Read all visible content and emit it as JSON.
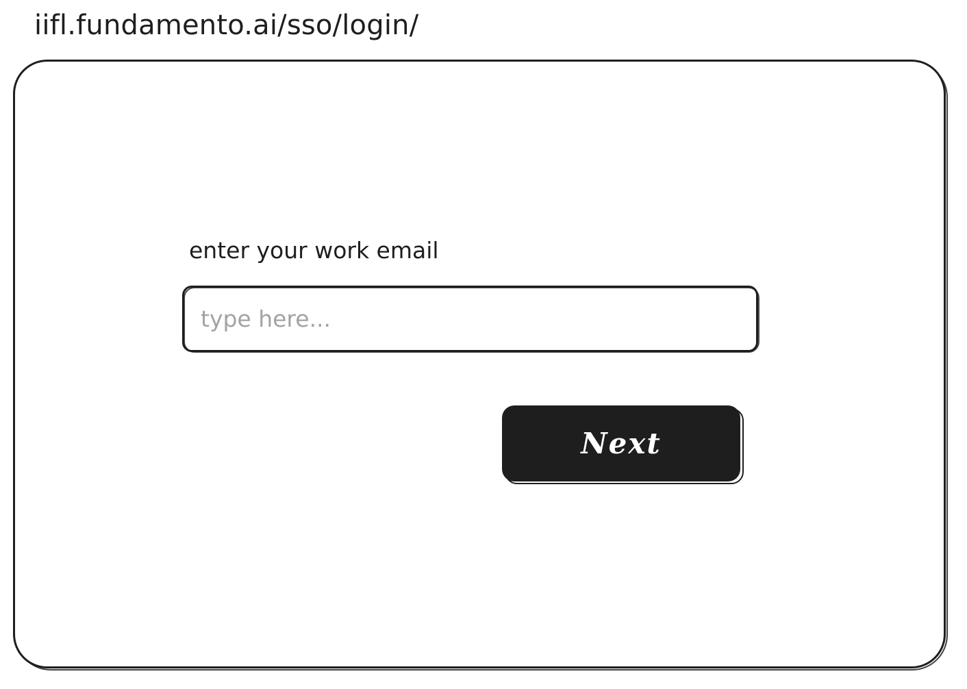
{
  "address_bar": {
    "url": "iifl.fundamento.ai/sso/login/"
  },
  "login_form": {
    "email_label": "enter your work email",
    "email_placeholder": "type here...",
    "email_value": "",
    "next_label": "Next"
  },
  "colors": {
    "stroke": "#1e1e1e",
    "background": "#ffffff",
    "placeholder": "#a3a3a3",
    "button_text": "#ffffff"
  }
}
